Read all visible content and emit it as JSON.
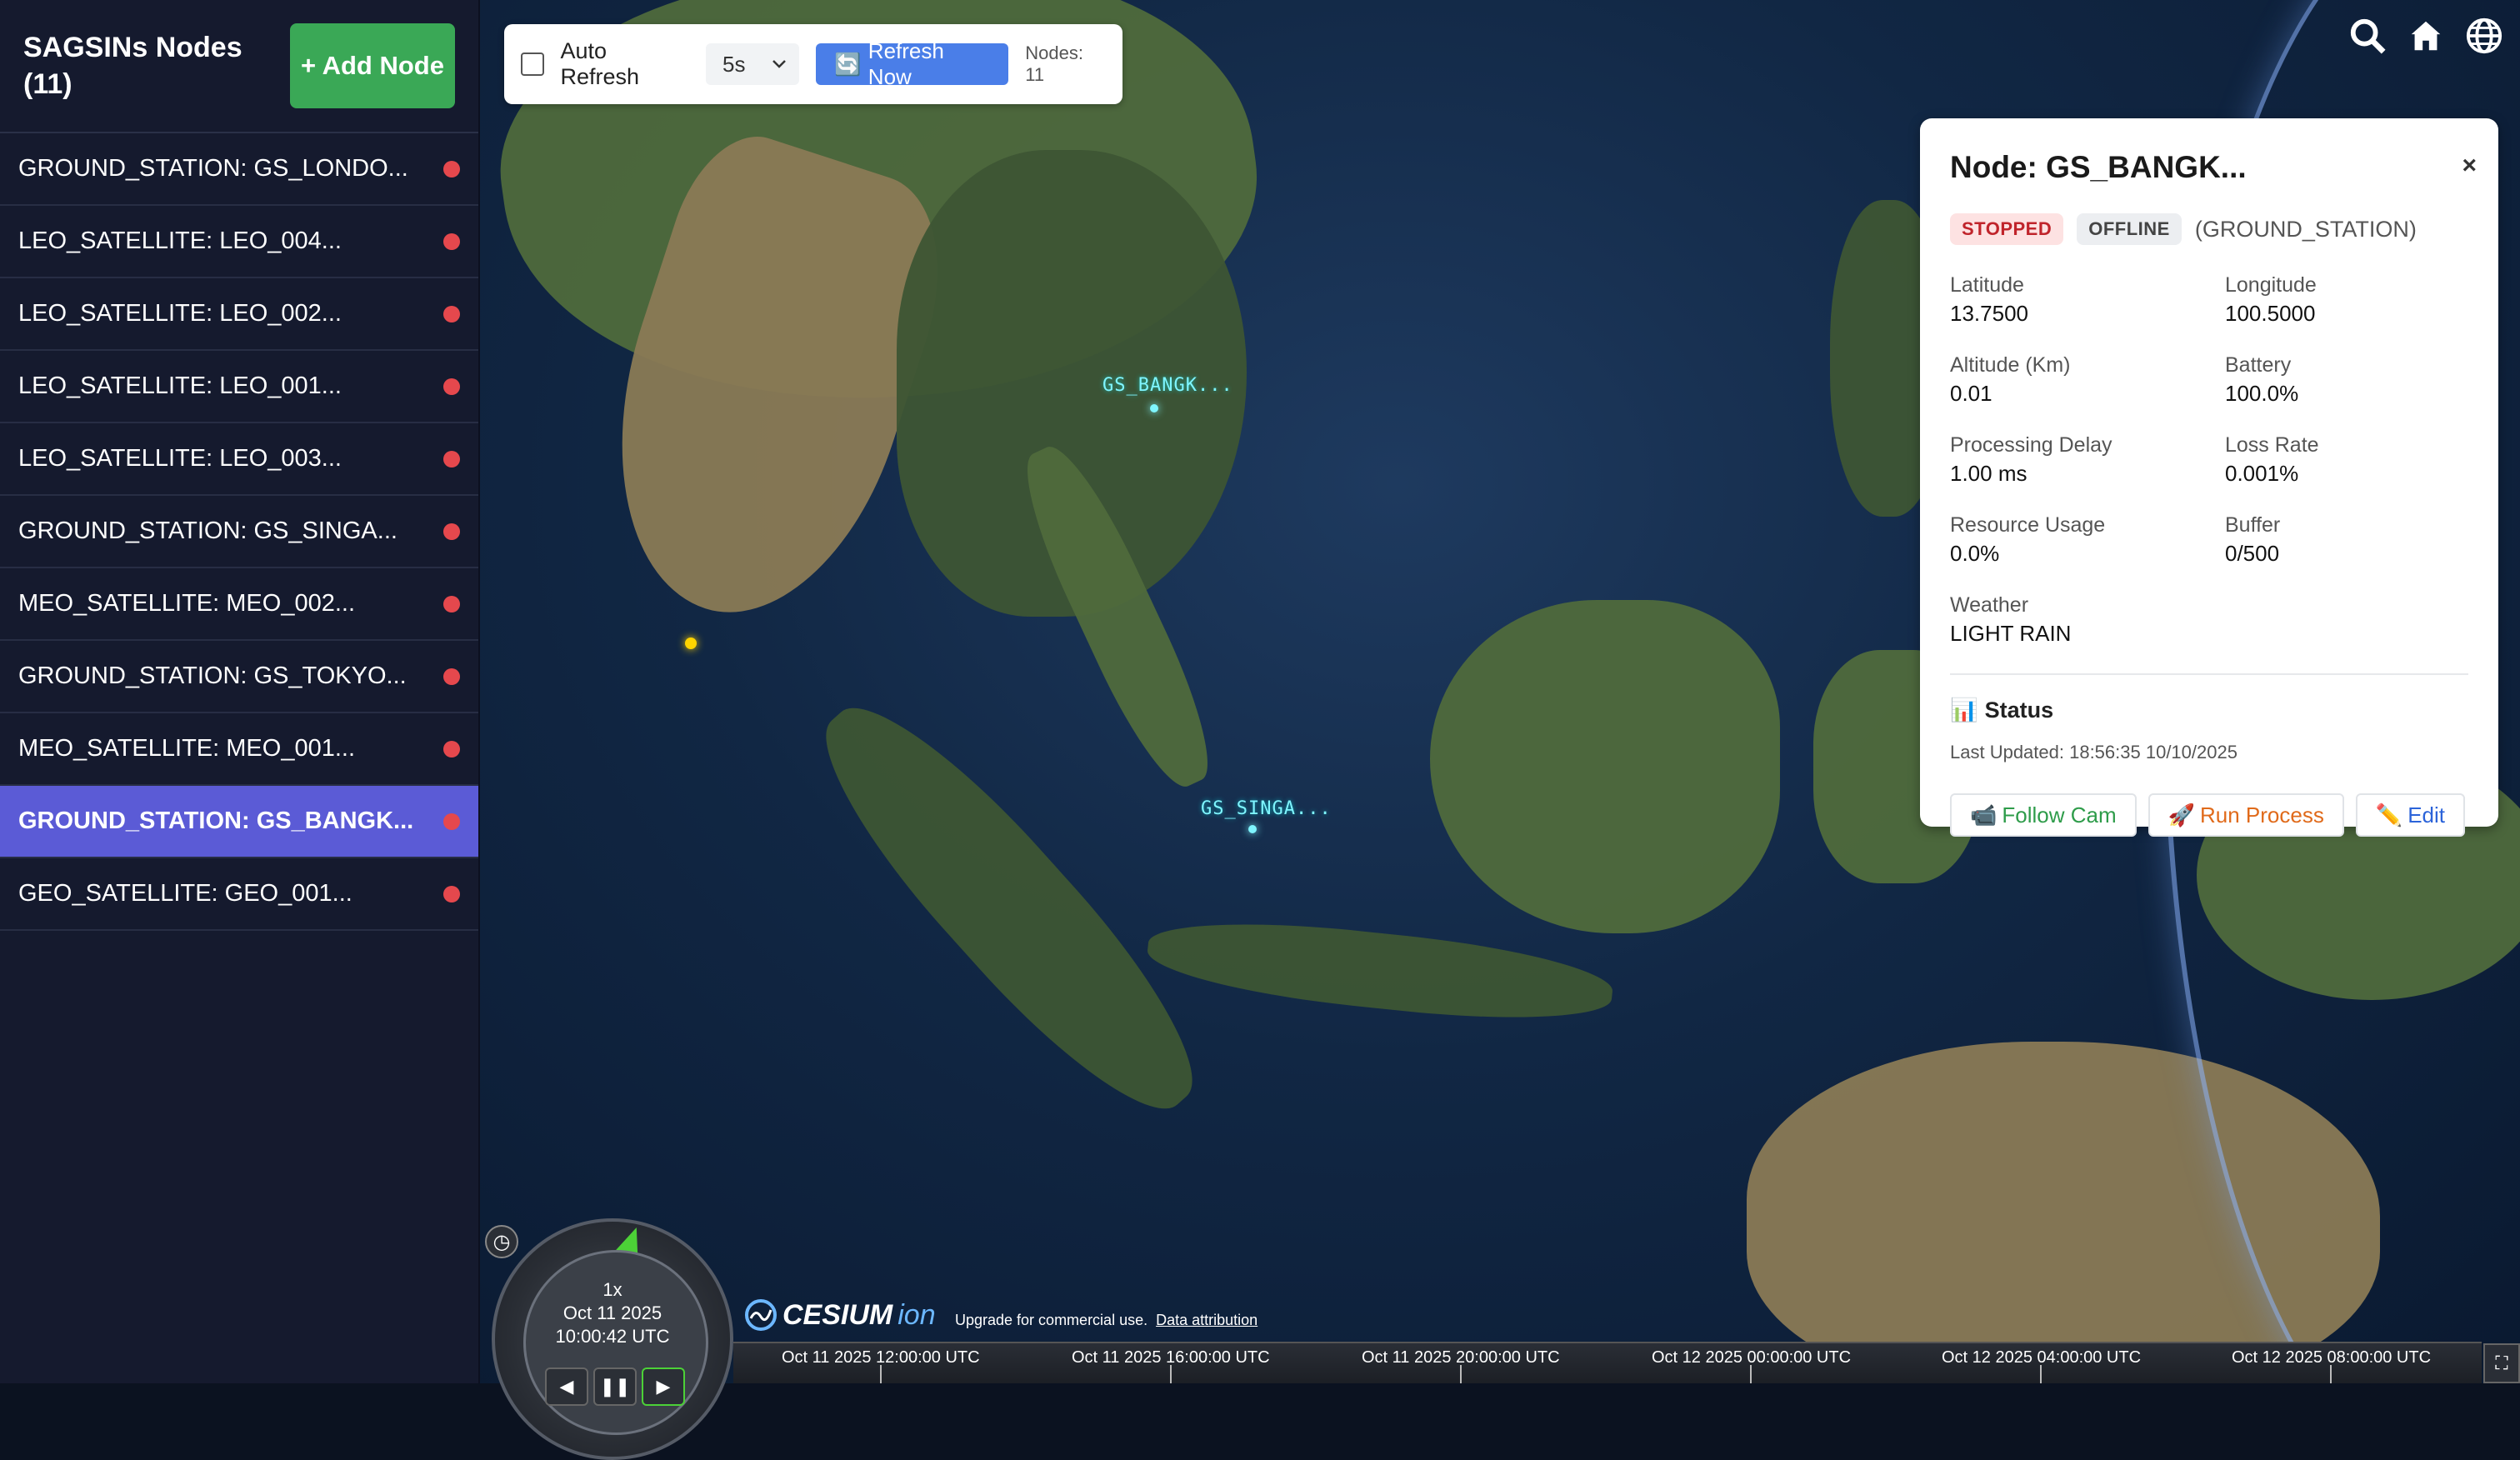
{
  "sidebar": {
    "title": "SAGSINs Nodes (11)",
    "add_button": "+ Add Node",
    "items": [
      {
        "label": "GROUND_STATION: GS_LONDO...",
        "active": false
      },
      {
        "label": "LEO_SATELLITE: LEO_004...",
        "active": false
      },
      {
        "label": "LEO_SATELLITE: LEO_002...",
        "active": false
      },
      {
        "label": "LEO_SATELLITE: LEO_001...",
        "active": false
      },
      {
        "label": "LEO_SATELLITE: LEO_003...",
        "active": false
      },
      {
        "label": "GROUND_STATION: GS_SINGA...",
        "active": false
      },
      {
        "label": "MEO_SATELLITE: MEO_002...",
        "active": false
      },
      {
        "label": "GROUND_STATION: GS_TOKYO...",
        "active": false
      },
      {
        "label": "MEO_SATELLITE: MEO_001...",
        "active": false
      },
      {
        "label": "GROUND_STATION: GS_BANGK...",
        "active": true
      },
      {
        "label": "GEO_SATELLITE: GEO_001...",
        "active": false
      }
    ],
    "status_color": "#e5484d",
    "active_color": "#5b5bd6"
  },
  "toolbar": {
    "auto_refresh_label": "Auto Refresh",
    "auto_refresh_checked": false,
    "interval_value": "5s",
    "refresh_now_label": "Refresh Now",
    "nodes_count": "Nodes: 11"
  },
  "map": {
    "labels": {
      "bangkok": "GS_BANGK...",
      "singapore": "GS_SINGA..."
    },
    "icons": [
      "search-icon",
      "home-icon",
      "globe-icon"
    ]
  },
  "panel": {
    "title": "Node: GS_BANGK...",
    "close": "×",
    "state_badge": "STOPPED",
    "conn_badge": "OFFLINE",
    "type": "(GROUND_STATION)",
    "fields": {
      "latitude_label": "Latitude",
      "latitude": "13.7500",
      "longitude_label": "Longitude",
      "longitude": "100.5000",
      "altitude_label": "Altitude (Km)",
      "altitude": "0.01",
      "battery_label": "Battery",
      "battery": "100.0%",
      "processing_delay_label": "Processing Delay",
      "processing_delay": "1.00 ms",
      "loss_rate_label": "Loss Rate",
      "loss_rate": "0.001%",
      "resource_usage_label": "Resource Usage",
      "resource_usage": "0.0%",
      "buffer_label": "Buffer",
      "buffer": "0/500",
      "weather_label": "Weather",
      "weather": "LIGHT RAIN"
    },
    "status_heading": "Status",
    "last_updated": "Last Updated: 18:56:35 10/10/2025",
    "actions": {
      "follow_cam": "Follow Cam",
      "run_process": "Run Process",
      "edit": "Edit"
    }
  },
  "clock": {
    "speed": "1x",
    "date": "Oct 11 2025",
    "time": "10:00:42 UTC"
  },
  "credits": {
    "logo": "CESIUM",
    "logo_suffix": "ion",
    "upgrade_text": "Upgrade for commercial use.",
    "attribution_link": "Data attribution"
  },
  "timeline": {
    "labels": [
      "Oct 11 2025 12:00:00 UTC",
      "Oct 11 2025 16:00:00 UTC",
      "Oct 11 2025 20:00:00 UTC",
      "Oct 12 2025 00:00:00 UTC",
      "Oct 12 2025 04:00:00 UTC",
      "Oct 12 2025 08:00:00 UTC"
    ]
  }
}
